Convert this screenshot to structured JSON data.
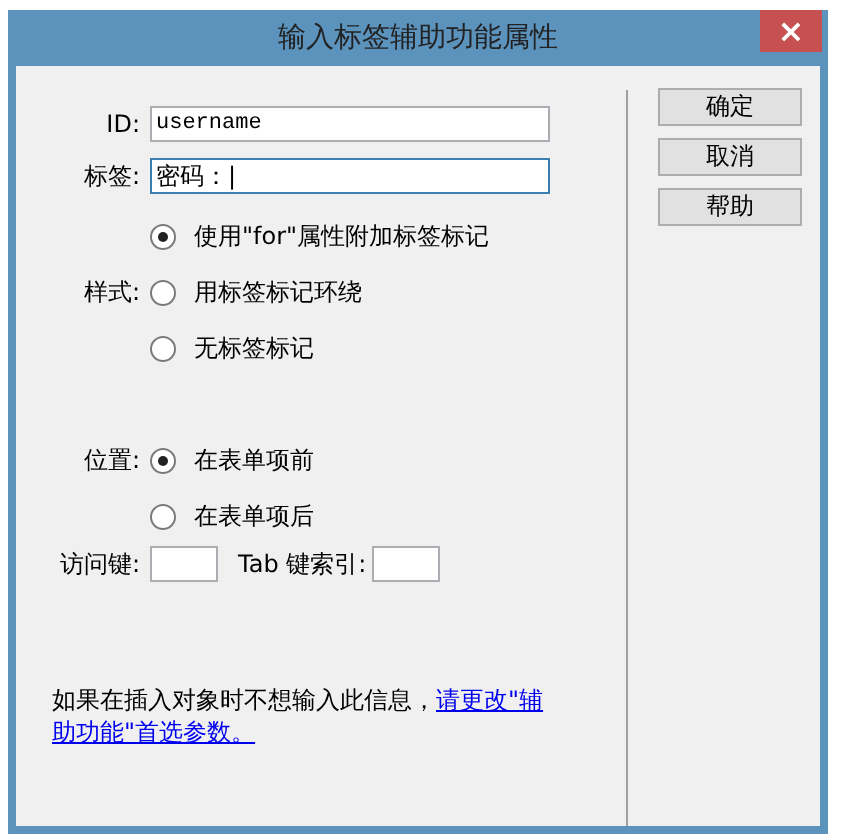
{
  "window": {
    "title": "输入标签辅助功能属性",
    "close": "×"
  },
  "fields": [
    {
      "label": "ID:",
      "value": "username",
      "focused": false,
      "mono": true
    },
    {
      "label": "标签:",
      "value": "密码：|",
      "focused": true,
      "mono": false
    }
  ],
  "style": {
    "label": "样式:",
    "options": [
      {
        "label": "使用\"for\"属性附加标签标记",
        "selected": true
      },
      {
        "label": "用标签标记环绕",
        "selected": false
      },
      {
        "label": "无标签标记",
        "selected": false
      }
    ]
  },
  "position": {
    "label": "位置:",
    "options": [
      {
        "label": "在表单项前",
        "selected": true
      },
      {
        "label": "在表单项后",
        "selected": false
      }
    ]
  },
  "access_key": {
    "label": "访问键:"
  },
  "tab_index": {
    "label": "Tab 键索引:"
  },
  "note": {
    "text": "如果在插入对象时不想输入此信息，",
    "link_lines": [
      "请更改\"辅",
      "助功能\"首选参数。"
    ]
  },
  "buttons": [
    "确定",
    "取消",
    "帮助"
  ]
}
